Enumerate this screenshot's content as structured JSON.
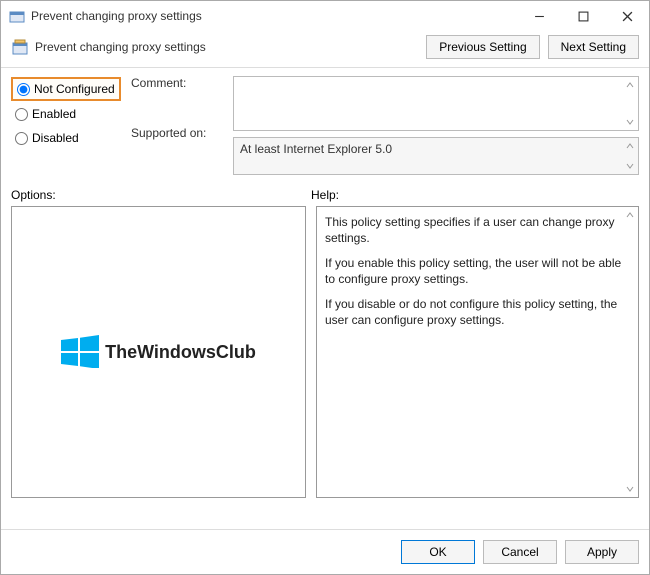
{
  "window": {
    "title": "Prevent changing proxy settings"
  },
  "header": {
    "title": "Prevent changing proxy settings",
    "prev_button": "Previous Setting",
    "next_button": "Next Setting"
  },
  "state": {
    "options": [
      {
        "label": "Not Configured",
        "value": "not_configured",
        "selected": true,
        "highlight": true
      },
      {
        "label": "Enabled",
        "value": "enabled",
        "selected": false,
        "highlight": false
      },
      {
        "label": "Disabled",
        "value": "disabled",
        "selected": false,
        "highlight": false
      }
    ]
  },
  "comment": {
    "label": "Comment:",
    "value": ""
  },
  "supported": {
    "label": "Supported on:",
    "value": "At least Internet Explorer 5.0"
  },
  "options_panel": {
    "label": "Options:"
  },
  "help_panel": {
    "label": "Help:",
    "paragraphs": [
      "This policy setting specifies if a user can change proxy settings.",
      "If you enable this policy setting, the user will not be able to configure proxy settings.",
      "If you disable or do not configure this policy setting, the user can configure proxy settings."
    ]
  },
  "watermark": {
    "text": "TheWindowsClub"
  },
  "footer": {
    "ok": "OK",
    "cancel": "Cancel",
    "apply": "Apply"
  }
}
